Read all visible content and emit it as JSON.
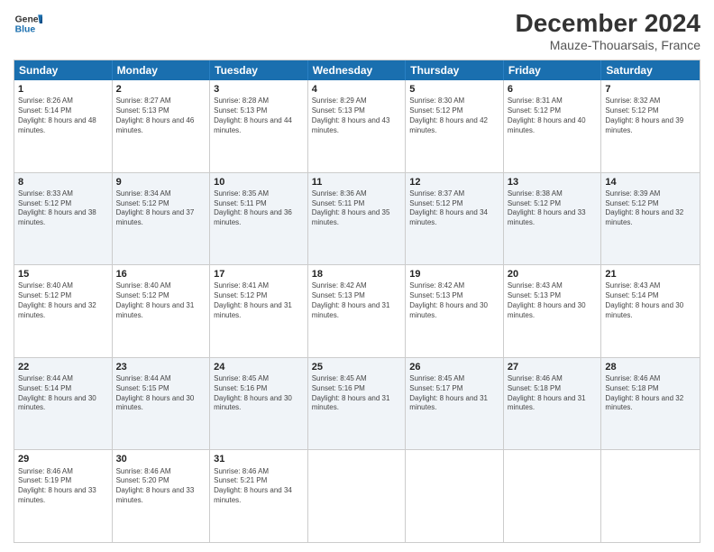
{
  "header": {
    "logo_line1": "General",
    "logo_line2": "Blue",
    "month": "December 2024",
    "location": "Mauze-Thouarsais, France"
  },
  "days": [
    "Sunday",
    "Monday",
    "Tuesday",
    "Wednesday",
    "Thursday",
    "Friday",
    "Saturday"
  ],
  "weeks": [
    [
      {
        "day": "1",
        "sunrise": "Sunrise: 8:26 AM",
        "sunset": "Sunset: 5:14 PM",
        "daylight": "Daylight: 8 hours and 48 minutes."
      },
      {
        "day": "2",
        "sunrise": "Sunrise: 8:27 AM",
        "sunset": "Sunset: 5:13 PM",
        "daylight": "Daylight: 8 hours and 46 minutes."
      },
      {
        "day": "3",
        "sunrise": "Sunrise: 8:28 AM",
        "sunset": "Sunset: 5:13 PM",
        "daylight": "Daylight: 8 hours and 44 minutes."
      },
      {
        "day": "4",
        "sunrise": "Sunrise: 8:29 AM",
        "sunset": "Sunset: 5:13 PM",
        "daylight": "Daylight: 8 hours and 43 minutes."
      },
      {
        "day": "5",
        "sunrise": "Sunrise: 8:30 AM",
        "sunset": "Sunset: 5:12 PM",
        "daylight": "Daylight: 8 hours and 42 minutes."
      },
      {
        "day": "6",
        "sunrise": "Sunrise: 8:31 AM",
        "sunset": "Sunset: 5:12 PM",
        "daylight": "Daylight: 8 hours and 40 minutes."
      },
      {
        "day": "7",
        "sunrise": "Sunrise: 8:32 AM",
        "sunset": "Sunset: 5:12 PM",
        "daylight": "Daylight: 8 hours and 39 minutes."
      }
    ],
    [
      {
        "day": "8",
        "sunrise": "Sunrise: 8:33 AM",
        "sunset": "Sunset: 5:12 PM",
        "daylight": "Daylight: 8 hours and 38 minutes."
      },
      {
        "day": "9",
        "sunrise": "Sunrise: 8:34 AM",
        "sunset": "Sunset: 5:12 PM",
        "daylight": "Daylight: 8 hours and 37 minutes."
      },
      {
        "day": "10",
        "sunrise": "Sunrise: 8:35 AM",
        "sunset": "Sunset: 5:11 PM",
        "daylight": "Daylight: 8 hours and 36 minutes."
      },
      {
        "day": "11",
        "sunrise": "Sunrise: 8:36 AM",
        "sunset": "Sunset: 5:11 PM",
        "daylight": "Daylight: 8 hours and 35 minutes."
      },
      {
        "day": "12",
        "sunrise": "Sunrise: 8:37 AM",
        "sunset": "Sunset: 5:12 PM",
        "daylight": "Daylight: 8 hours and 34 minutes."
      },
      {
        "day": "13",
        "sunrise": "Sunrise: 8:38 AM",
        "sunset": "Sunset: 5:12 PM",
        "daylight": "Daylight: 8 hours and 33 minutes."
      },
      {
        "day": "14",
        "sunrise": "Sunrise: 8:39 AM",
        "sunset": "Sunset: 5:12 PM",
        "daylight": "Daylight: 8 hours and 32 minutes."
      }
    ],
    [
      {
        "day": "15",
        "sunrise": "Sunrise: 8:40 AM",
        "sunset": "Sunset: 5:12 PM",
        "daylight": "Daylight: 8 hours and 32 minutes."
      },
      {
        "day": "16",
        "sunrise": "Sunrise: 8:40 AM",
        "sunset": "Sunset: 5:12 PM",
        "daylight": "Daylight: 8 hours and 31 minutes."
      },
      {
        "day": "17",
        "sunrise": "Sunrise: 8:41 AM",
        "sunset": "Sunset: 5:12 PM",
        "daylight": "Daylight: 8 hours and 31 minutes."
      },
      {
        "day": "18",
        "sunrise": "Sunrise: 8:42 AM",
        "sunset": "Sunset: 5:13 PM",
        "daylight": "Daylight: 8 hours and 31 minutes."
      },
      {
        "day": "19",
        "sunrise": "Sunrise: 8:42 AM",
        "sunset": "Sunset: 5:13 PM",
        "daylight": "Daylight: 8 hours and 30 minutes."
      },
      {
        "day": "20",
        "sunrise": "Sunrise: 8:43 AM",
        "sunset": "Sunset: 5:13 PM",
        "daylight": "Daylight: 8 hours and 30 minutes."
      },
      {
        "day": "21",
        "sunrise": "Sunrise: 8:43 AM",
        "sunset": "Sunset: 5:14 PM",
        "daylight": "Daylight: 8 hours and 30 minutes."
      }
    ],
    [
      {
        "day": "22",
        "sunrise": "Sunrise: 8:44 AM",
        "sunset": "Sunset: 5:14 PM",
        "daylight": "Daylight: 8 hours and 30 minutes."
      },
      {
        "day": "23",
        "sunrise": "Sunrise: 8:44 AM",
        "sunset": "Sunset: 5:15 PM",
        "daylight": "Daylight: 8 hours and 30 minutes."
      },
      {
        "day": "24",
        "sunrise": "Sunrise: 8:45 AM",
        "sunset": "Sunset: 5:16 PM",
        "daylight": "Daylight: 8 hours and 30 minutes."
      },
      {
        "day": "25",
        "sunrise": "Sunrise: 8:45 AM",
        "sunset": "Sunset: 5:16 PM",
        "daylight": "Daylight: 8 hours and 31 minutes."
      },
      {
        "day": "26",
        "sunrise": "Sunrise: 8:45 AM",
        "sunset": "Sunset: 5:17 PM",
        "daylight": "Daylight: 8 hours and 31 minutes."
      },
      {
        "day": "27",
        "sunrise": "Sunrise: 8:46 AM",
        "sunset": "Sunset: 5:18 PM",
        "daylight": "Daylight: 8 hours and 31 minutes."
      },
      {
        "day": "28",
        "sunrise": "Sunrise: 8:46 AM",
        "sunset": "Sunset: 5:18 PM",
        "daylight": "Daylight: 8 hours and 32 minutes."
      }
    ],
    [
      {
        "day": "29",
        "sunrise": "Sunrise: 8:46 AM",
        "sunset": "Sunset: 5:19 PM",
        "daylight": "Daylight: 8 hours and 33 minutes."
      },
      {
        "day": "30",
        "sunrise": "Sunrise: 8:46 AM",
        "sunset": "Sunset: 5:20 PM",
        "daylight": "Daylight: 8 hours and 33 minutes."
      },
      {
        "day": "31",
        "sunrise": "Sunrise: 8:46 AM",
        "sunset": "Sunset: 5:21 PM",
        "daylight": "Daylight: 8 hours and 34 minutes."
      },
      null,
      null,
      null,
      null
    ]
  ]
}
